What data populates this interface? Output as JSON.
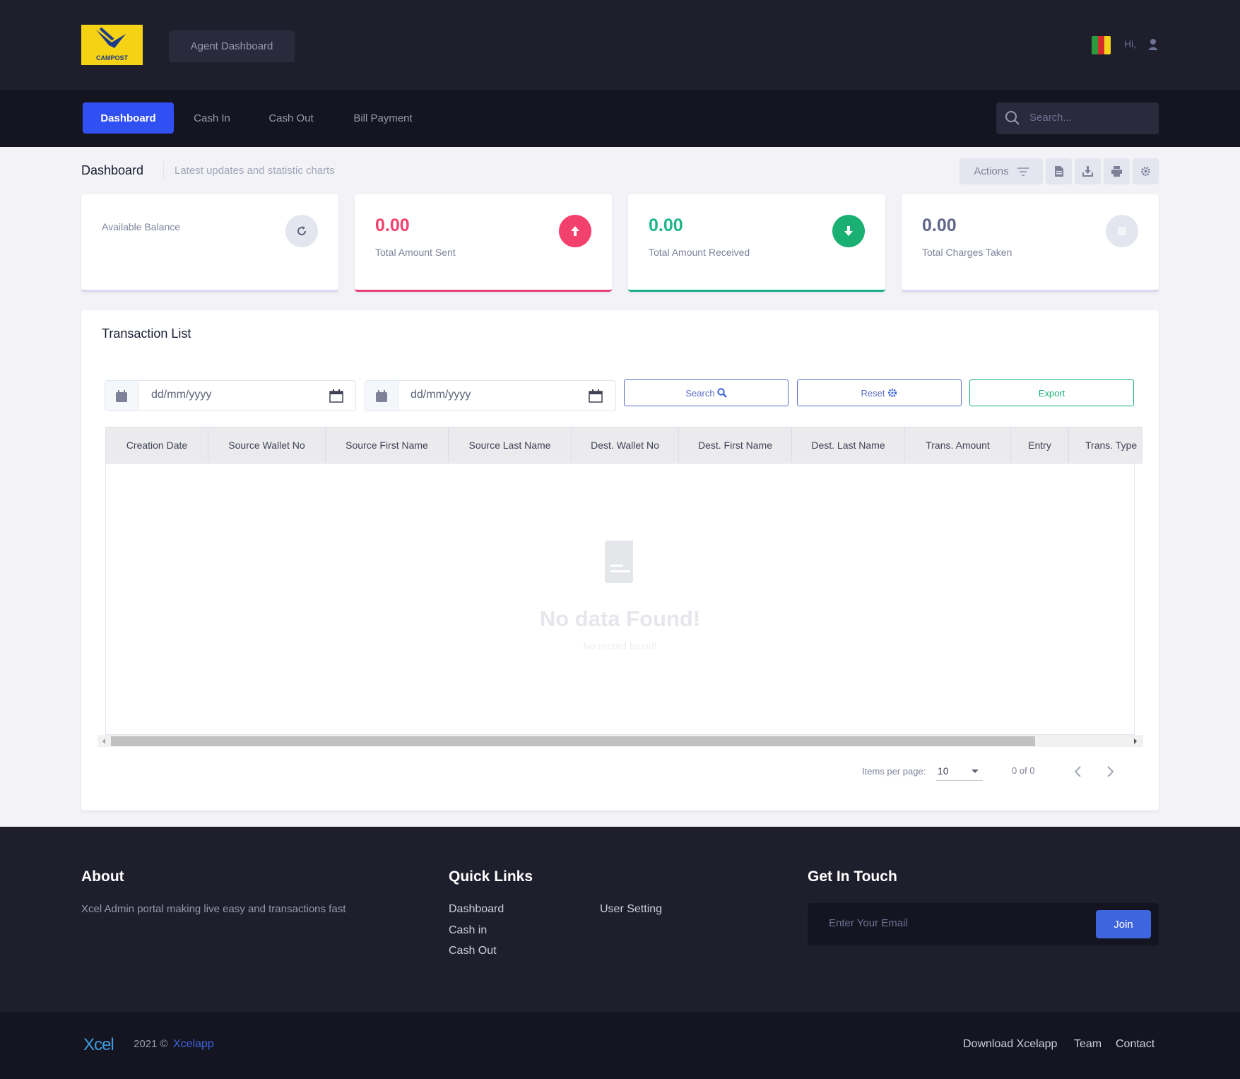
{
  "header": {
    "logo_text": "CAMPOST",
    "agent_button": "Agent Dashboard",
    "greeting": "Hi,",
    "flag_colors": [
      "#2c9a3f",
      "#d62b2b",
      "#f3d21a"
    ]
  },
  "nav": {
    "items": [
      {
        "label": "Dashboard",
        "active": true
      },
      {
        "label": "Cash In"
      },
      {
        "label": "Cash Out"
      },
      {
        "label": "Bill Payment"
      }
    ],
    "search_placeholder": "Search..."
  },
  "subheader": {
    "title": "Dashboard",
    "subtitle": "Latest updates and statistic charts",
    "actions_label": "Actions"
  },
  "stats": [
    {
      "value": "",
      "label": "Available Balance",
      "color": "#7e8299",
      "accent": "#d6d9ef",
      "icon": "refresh-icon"
    },
    {
      "value": "0.00",
      "label": "Total Amount Sent",
      "color": "#f1416c",
      "accent": "#e8417a",
      "icon": "arrow-up-icon"
    },
    {
      "value": "0.00",
      "label": "Total Amount Received",
      "color": "#1fb589",
      "accent": "#1aaf8b",
      "icon": "arrow-down-icon"
    },
    {
      "value": "0.00",
      "label": "Total Charges Taken",
      "color": "#5f6689",
      "accent": "#d6d9ef",
      "icon": "receipt-icon"
    }
  ],
  "transactions": {
    "title": "Transaction List",
    "date_placeholder": "dd/mm/yyyy",
    "buttons": {
      "search": "Search",
      "reset": "Reset",
      "export": "Export"
    },
    "columns": [
      "Creation Date",
      "Source Wallet No",
      "Source First Name",
      "Source Last Name",
      "Dest. Wallet No",
      "Dest. First Name",
      "Dest. Last Name",
      "Trans. Amount",
      "Entry",
      "Trans. Type"
    ],
    "empty_title": "No data Found!",
    "empty_subtitle": "No record found!",
    "pager": {
      "label": "Items per page:",
      "per_page": "10",
      "range": "0 of 0"
    }
  },
  "footer": {
    "about_title": "About",
    "about_text": "Xcel Admin portal making live easy and transactions fast",
    "links_title": "Quick Links",
    "links_col1": [
      "Dashboard",
      "Cash in",
      "Cash Out"
    ],
    "links_col2": [
      "User Setting"
    ],
    "touch_title": "Get In Touch",
    "email_placeholder": "Enter Your Email",
    "join_label": "Join"
  },
  "bottom": {
    "brand": "Xcel",
    "year": "2021 ©",
    "company": "Xcelapp",
    "links": [
      "Download Xcelapp",
      "Team",
      "Contact"
    ]
  }
}
